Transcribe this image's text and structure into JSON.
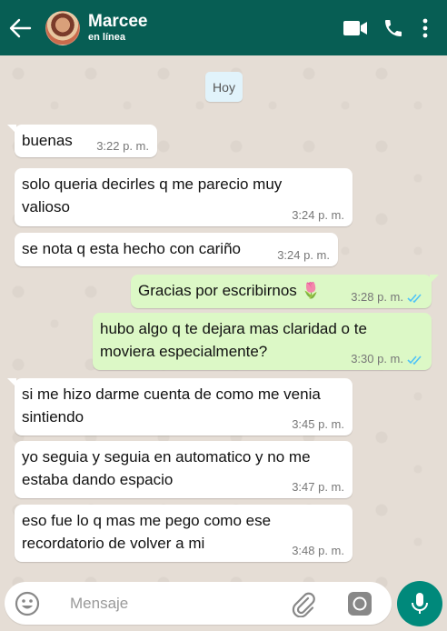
{
  "header": {
    "contact_name": "Marcee",
    "status": "en línea",
    "icons": [
      "back-arrow-icon",
      "video-call-icon",
      "phone-icon",
      "more-options-icon"
    ]
  },
  "date_chip": "Hoy",
  "messages": [
    {
      "direction": "in",
      "text": "buenas",
      "time": "3:22 p. m."
    },
    {
      "direction": "in",
      "text": "solo queria decirles q me parecio muy\nvalioso",
      "time": "3:24 p. m."
    },
    {
      "direction": "in",
      "text": "se nota q esta hecho con cariño",
      "time": "3:24 p. m."
    },
    {
      "direction": "out",
      "text": "Gracias por escribirnos 🌷",
      "time": "3:28 p. m.",
      "read": true
    },
    {
      "direction": "out",
      "text": "hubo algo q te dejara mas claridad o te\nmoviera especialmente?",
      "time": "3:30 p. m.",
      "read": true
    },
    {
      "direction": "in",
      "text": "si me hizo darme cuenta de como me venia\nsintiendo",
      "time": "3:45 p. m."
    },
    {
      "direction": "in",
      "text": "yo seguia y seguia en automatico y no me\nestaba dando espacio",
      "time": "3:47 p. m."
    },
    {
      "direction": "in",
      "text": "eso fue lo q mas me pego como ese\nrecordatorio de volver a mi",
      "time": "3:48 p. m."
    }
  ],
  "composer": {
    "placeholder": "Mensaje",
    "icons": [
      "emoji-icon",
      "attach-icon",
      "camera-icon",
      "mic-icon"
    ]
  },
  "colors": {
    "header": "#075e54",
    "incoming": "#ffffff",
    "outgoing": "#dcf8c6",
    "read_ticks": "#4fc3f7",
    "mic_button": "#00897b"
  }
}
